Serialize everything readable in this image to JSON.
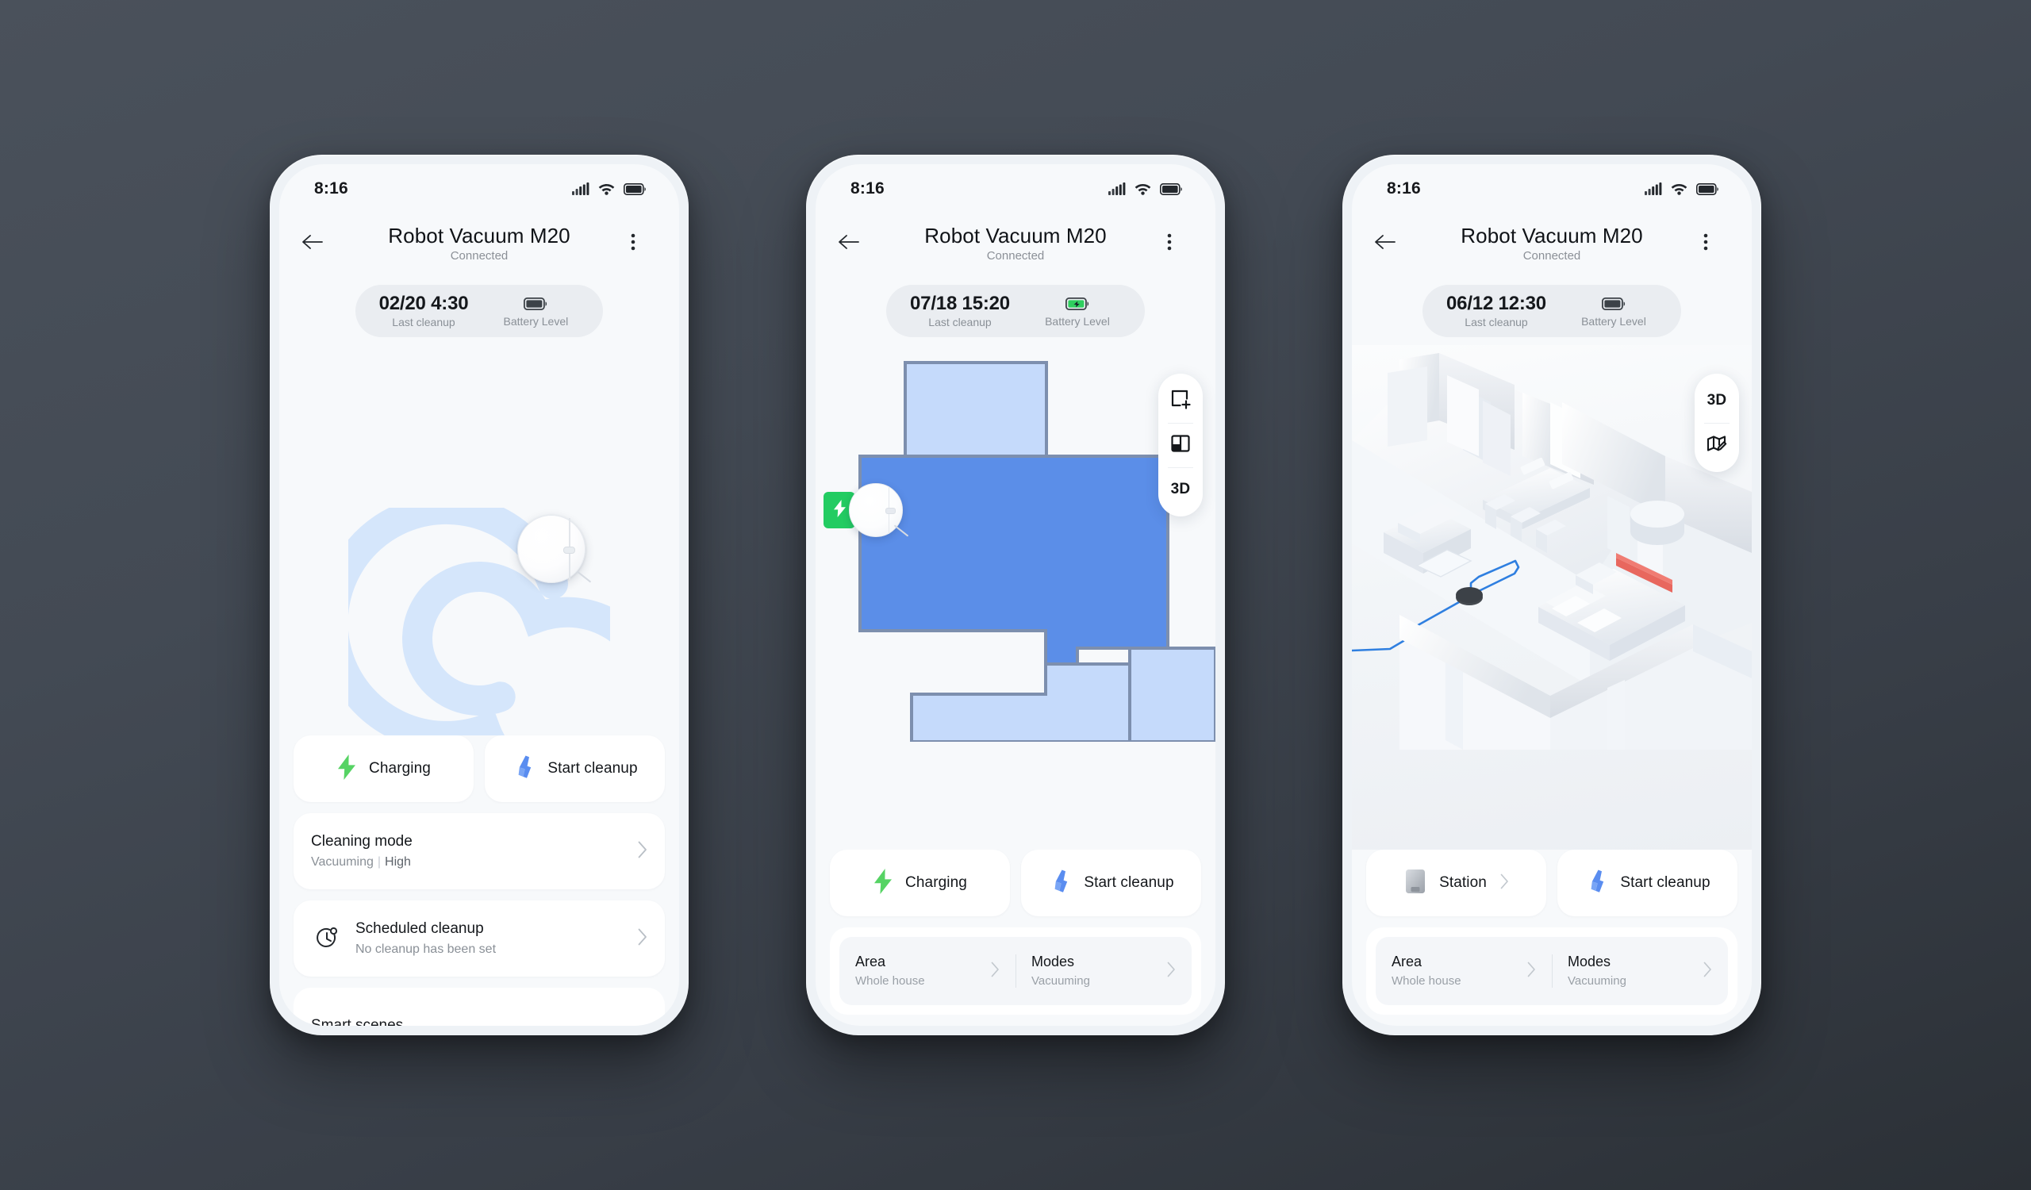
{
  "theme": {
    "bg_top": "#4a515b",
    "bg_bottom": "#2b3036",
    "accent_blue": "#5a8df0",
    "accent_green": "#56d364",
    "map_room_active": "#5b8ee8",
    "map_room_idle": "#c5dafb",
    "map_wall": "#7d8fae",
    "dock_green": "#23cc62",
    "path_blue": "#2f7fe0",
    "nogo_red": "#e8675e"
  },
  "phones": [
    {
      "id": "phone-idle",
      "status_bar": {
        "time": "8:16",
        "signal_icon": "cellular-signal-icon",
        "wifi_icon": "wifi-icon",
        "battery_icon": "battery-icon"
      },
      "header": {
        "back_icon": "arrow-left-icon",
        "title": "Robot Vacuum M20",
        "subtitle": "Connected",
        "menu_icon": "more-vertical-icon"
      },
      "pill": {
        "value": "02/20 4:30",
        "value_label": "Last cleanup",
        "battery_label": "Battery Level",
        "battery_icon": "battery-icon",
        "battery_charging": false
      },
      "hero": {
        "type": "spiral",
        "robot_icon": "robot-vacuum-icon"
      },
      "actions": [
        {
          "name": "charging",
          "icon": "bolt-icon",
          "label": "Charging",
          "chevron": false
        },
        {
          "name": "start-cleanup",
          "icon": "brush-icon",
          "label": "Start cleanup",
          "chevron": false
        }
      ],
      "list_items": [
        {
          "name": "cleaning-mode",
          "icon": null,
          "title": "Cleaning mode",
          "sub_left": "Vacuuming",
          "sub_right": "High",
          "chevron": "chevron-right-icon"
        },
        {
          "name": "scheduled-cleanup",
          "icon": "schedule-clock-icon",
          "title": "Scheduled cleanup",
          "sub_left": "No cleanup has been set",
          "sub_right": "",
          "chevron": "chevron-right-icon"
        }
      ],
      "clipped_item": {
        "name": "smart-scenes",
        "title": "Smart scenes"
      }
    },
    {
      "id": "phone-map2d",
      "status_bar": {
        "time": "8:16",
        "signal_icon": "cellular-signal-icon",
        "wifi_icon": "wifi-icon",
        "battery_icon": "battery-icon"
      },
      "header": {
        "back_icon": "arrow-left-icon",
        "title": "Robot Vacuum M20",
        "subtitle": "Connected",
        "menu_icon": "more-vertical-icon"
      },
      "pill": {
        "value": "07/18 15:20",
        "value_label": "Last cleanup",
        "battery_label": "Battery Level",
        "battery_icon": "battery-charging-icon",
        "battery_charging": true
      },
      "hero": {
        "type": "map2d",
        "dock_icon": "bolt-icon",
        "robot_icon": "robot-vacuum-icon",
        "tools": [
          {
            "name": "add-zone",
            "icon": "square-plus-icon",
            "label": ""
          },
          {
            "name": "split-room",
            "icon": "split-layout-icon",
            "label": ""
          },
          {
            "name": "view-3d",
            "icon": null,
            "label": "3D"
          }
        ]
      },
      "actions": [
        {
          "name": "charging",
          "icon": "bolt-icon",
          "label": "Charging",
          "chevron": false
        },
        {
          "name": "start-cleanup",
          "icon": "brush-icon",
          "label": "Start cleanup",
          "chevron": false
        }
      ],
      "split_card": [
        {
          "name": "area",
          "title": "Area",
          "sub": "Whole house",
          "chevron": "chevron-right-icon"
        },
        {
          "name": "modes",
          "title": "Modes",
          "sub": "Vacuuming",
          "chevron": "chevron-right-icon"
        }
      ]
    },
    {
      "id": "phone-map3d",
      "status_bar": {
        "time": "8:16",
        "signal_icon": "cellular-signal-icon",
        "wifi_icon": "wifi-icon",
        "battery_icon": "battery-icon"
      },
      "header": {
        "back_icon": "arrow-left-icon",
        "title": "Robot Vacuum M20",
        "subtitle": "Connected",
        "menu_icon": "more-vertical-icon"
      },
      "pill": {
        "value": "06/12 12:30",
        "value_label": "Last cleanup",
        "battery_label": "Battery Level",
        "battery_icon": "battery-icon",
        "battery_charging": false
      },
      "hero": {
        "type": "map3d",
        "tools": [
          {
            "name": "view-3d",
            "icon": null,
            "label": "3D"
          },
          {
            "name": "edit-map",
            "icon": "map-edit-icon",
            "label": ""
          }
        ]
      },
      "actions": [
        {
          "name": "station",
          "icon": "station-icon",
          "label": "Station",
          "chevron": true
        },
        {
          "name": "start-cleanup",
          "icon": "brush-icon",
          "label": "Start cleanup",
          "chevron": false
        }
      ],
      "split_card": [
        {
          "name": "area",
          "title": "Area",
          "sub": "Whole house",
          "chevron": "chevron-right-icon"
        },
        {
          "name": "modes",
          "title": "Modes",
          "sub": "Vacuuming",
          "chevron": "chevron-right-icon"
        }
      ]
    }
  ]
}
